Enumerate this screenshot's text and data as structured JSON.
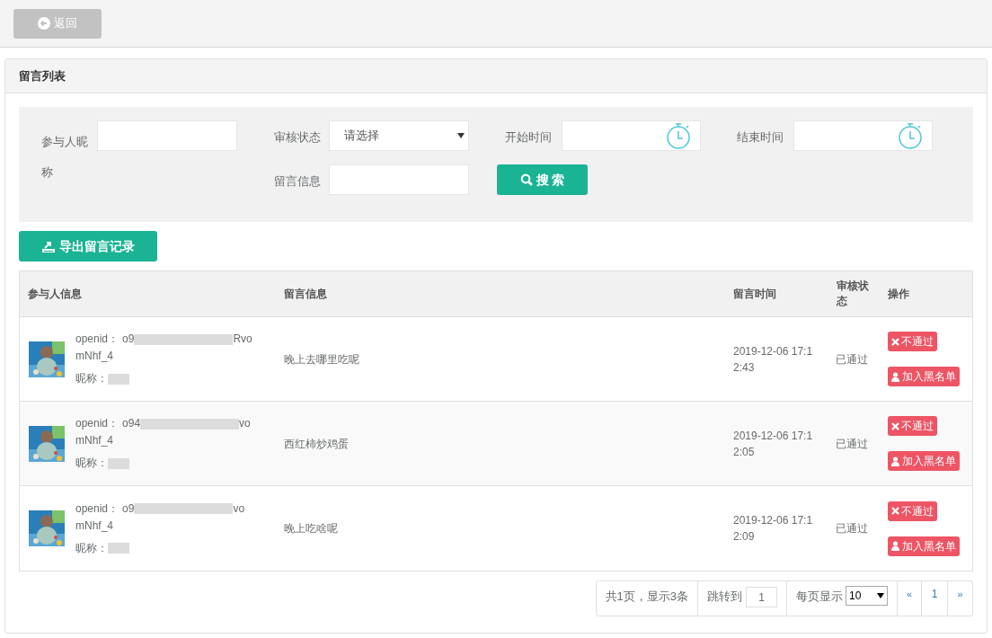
{
  "back_button": {
    "label": "返回"
  },
  "panel": {
    "title": "留言列表"
  },
  "filters": {
    "nickname_label": "参与人昵称",
    "status_label": "审核状态",
    "status_value": "请选择",
    "start_label": "开始时间",
    "end_label": "结束时间",
    "message_label": "留言信息",
    "search_button": "搜 索"
  },
  "export_button": "导出留言记录",
  "table": {
    "columns": [
      "参与人信息",
      "留言信息",
      "留言时间",
      "审核状态",
      "操作"
    ],
    "rows": [
      {
        "openid_label": "openid：",
        "openid_start": "o9",
        "openid_end": "Rvo",
        "openid_tail": "mNhf_4",
        "nickname_label": "昵称：",
        "message": "晚上去哪里吃呢",
        "time": "2019-12-06 17:12:43",
        "status": "已通过",
        "reject": "不通过",
        "blacklist": "加入黑名单"
      },
      {
        "openid_label": "openid：",
        "openid_start": "o94",
        "openid_end": "vo",
        "openid_tail": "mNhf_4",
        "nickname_label": "昵称：",
        "message": "西红柿炒鸡蛋",
        "time": "2019-12-06 17:12:05",
        "status": "已通过",
        "reject": "不通过",
        "blacklist": "加入黑名单"
      },
      {
        "openid_label": "openid：",
        "openid_start": "o9",
        "openid_end": "vo",
        "openid_tail": "mNhf_4",
        "nickname_label": "昵称：",
        "message": "晚上吃啥呢",
        "time": "2019-12-06 17:12:09",
        "status": "已通过",
        "reject": "不通过",
        "blacklist": "加入黑名单"
      }
    ]
  },
  "pagination": {
    "summary": "共1页，显示3条",
    "jump_label": "跳转到",
    "jump_value": "1",
    "page_size_label": "每页显示",
    "page_size": "10",
    "prev": "«",
    "current": "1",
    "next": "»"
  }
}
